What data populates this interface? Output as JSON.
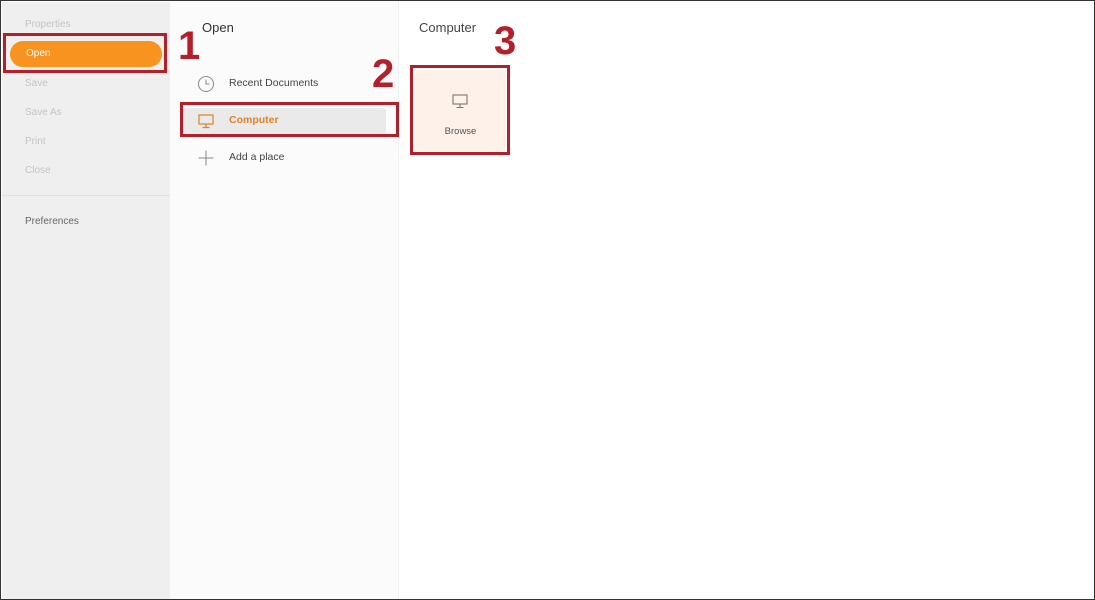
{
  "sidebar": {
    "items": [
      {
        "label": "Properties"
      },
      {
        "label": "Open"
      },
      {
        "label": "Save"
      },
      {
        "label": "Save As"
      },
      {
        "label": "Print"
      },
      {
        "label": "Close"
      }
    ],
    "preferences_label": "Preferences"
  },
  "open_panel": {
    "title": "Open",
    "places": [
      {
        "label": "Recent Documents",
        "icon": "clock-icon"
      },
      {
        "label": "Computer",
        "icon": "monitor-icon",
        "selected": true
      },
      {
        "label": "Add a place",
        "icon": "plus-icon"
      }
    ]
  },
  "location_panel": {
    "title": "Computer",
    "browse_label": "Browse",
    "browse_icon": "monitor-icon"
  },
  "annotations": {
    "step1": "1",
    "step2": "2",
    "step3": "3"
  },
  "colors": {
    "accent": "#f7931e",
    "selected_text": "#e2812a",
    "annotation": "#b3202a",
    "browse_tile": "#fdf1e9"
  }
}
